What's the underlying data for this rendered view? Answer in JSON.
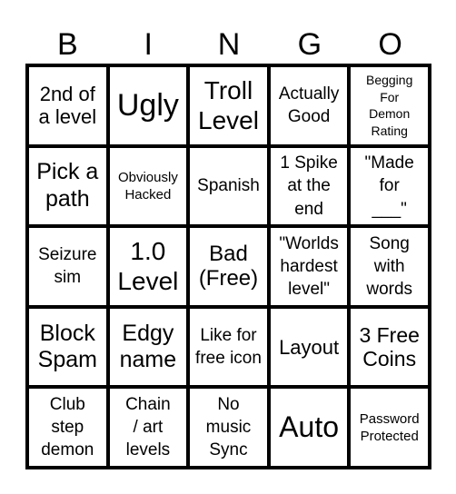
{
  "header": {
    "letters": [
      "B",
      "I",
      "N",
      "G",
      "O"
    ]
  },
  "board": {
    "rows": [
      [
        {
          "text": "2nd of a level"
        },
        {
          "text": "Ugly"
        },
        {
          "text": "Troll Level"
        },
        {
          "text": "Actually Good"
        },
        {
          "text": "Begging For Demon Rating"
        }
      ],
      [
        {
          "text": "Pick a path"
        },
        {
          "text": "Obviously Hacked"
        },
        {
          "text": "Spanish"
        },
        {
          "text": "1 Spike at the end"
        },
        {
          "text": "\"Made for ___\""
        }
      ],
      [
        {
          "text": "Seizure sim"
        },
        {
          "text": "1.0 Level"
        },
        {
          "text": "Bad (Free)"
        },
        {
          "text": "\"Worlds hardest level\""
        },
        {
          "text": "Song with words"
        }
      ],
      [
        {
          "text": "Block Spam"
        },
        {
          "text": "Edgy name"
        },
        {
          "text": "Like for free icon"
        },
        {
          "text": "Layout"
        },
        {
          "text": "3 Free Coins"
        }
      ],
      [
        {
          "text": "Club step demon"
        },
        {
          "text": "Chain / art levels"
        },
        {
          "text": "No music Sync"
        },
        {
          "text": "Auto"
        },
        {
          "text": "Password Protected"
        }
      ]
    ]
  }
}
